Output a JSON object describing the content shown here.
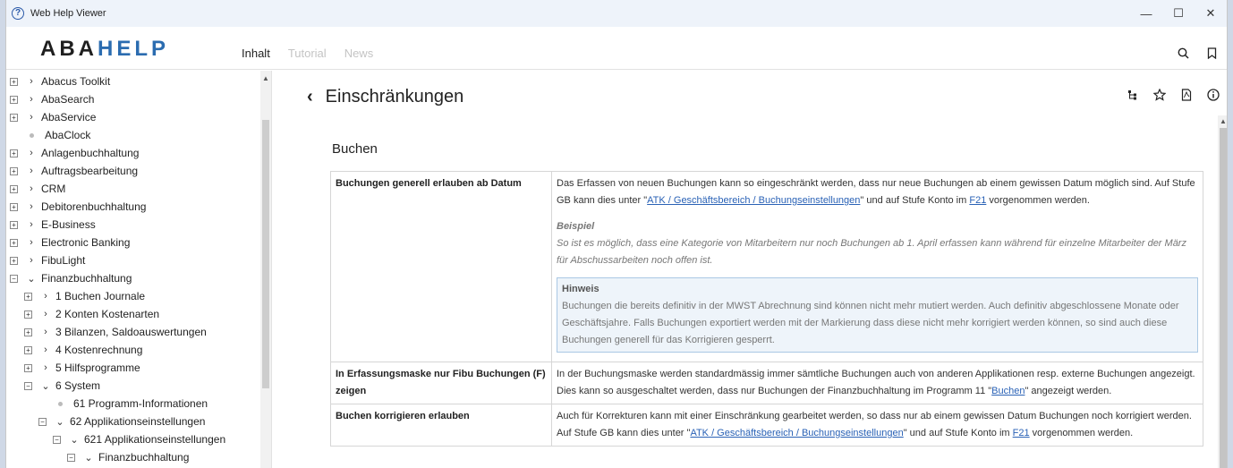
{
  "window": {
    "title": "Web Help Viewer",
    "minimize": "—",
    "maximize": "☐",
    "close": "✕"
  },
  "header": {
    "logo_a": "ABA",
    "logo_b": "HELP",
    "nav": {
      "inhalt": "Inhalt",
      "tutorial": "Tutorial",
      "news": "News"
    }
  },
  "sidebar": {
    "items": [
      {
        "label": "Abacus Toolkit",
        "box": "+",
        "chev": "›"
      },
      {
        "label": "AbaSearch",
        "box": "+",
        "chev": "›"
      },
      {
        "label": "AbaService",
        "box": "+",
        "chev": "›"
      },
      {
        "label": "AbaClock",
        "box": "",
        "chev": ""
      },
      {
        "label": "Anlagenbuchhaltung",
        "box": "+",
        "chev": "›"
      },
      {
        "label": "Auftragsbearbeitung",
        "box": "+",
        "chev": "›"
      },
      {
        "label": "CRM",
        "box": "+",
        "chev": "›"
      },
      {
        "label": "Debitorenbuchhaltung",
        "box": "+",
        "chev": "›"
      },
      {
        "label": "E-Business",
        "box": "+",
        "chev": "›"
      },
      {
        "label": "Electronic Banking",
        "box": "+",
        "chev": "›"
      },
      {
        "label": "FibuLight",
        "box": "+",
        "chev": "›"
      },
      {
        "label": "Finanzbuchhaltung",
        "box": "−",
        "chev": "⌄"
      },
      {
        "label": "1 Buchen Journale",
        "box": "+",
        "chev": "›"
      },
      {
        "label": "2 Konten Kostenarten",
        "box": "+",
        "chev": "›"
      },
      {
        "label": "3 Bilanzen, Saldoauswertungen",
        "box": "+",
        "chev": "›"
      },
      {
        "label": "4 Kostenrechnung",
        "box": "+",
        "chev": "›"
      },
      {
        "label": "5 Hilfsprogramme",
        "box": "+",
        "chev": "›"
      },
      {
        "label": "6 System",
        "box": "−",
        "chev": "⌄"
      },
      {
        "label": "61 Programm-Informationen",
        "box": "",
        "chev": ""
      },
      {
        "label": "62 Applikationseinstellungen",
        "box": "−",
        "chev": "⌄"
      },
      {
        "label": "621 Applikationseinstellungen",
        "box": "−",
        "chev": "⌄"
      },
      {
        "label": "Finanzbuchhaltung",
        "box": "−",
        "chev": "⌄"
      }
    ]
  },
  "content": {
    "title": "Einschränkungen",
    "section": "Buchen",
    "rows": {
      "r1": {
        "label": "Buchungen generell erlauben ab Datum",
        "text_a": "Das Erfassen von neuen Buchungen kann so eingeschränkt werden, dass nur neue Buchungen ab einem gewissen Datum möglich sind. Auf Stufe GB kann dies unter \"",
        "link_a": "ATK / Geschäftsbereich / Buchungseinstellungen",
        "text_b": "\" und auf Stufe Konto im ",
        "link_b": "F21",
        "text_c": " vorgenommen werden.",
        "example_title": "Beispiel",
        "example_text": "So ist es möglich, dass eine Kategorie von Mitarbeitern nur noch Buchungen ab 1. April erfassen kann während für einzelne Mitarbeiter der März für Abschussarbeiten noch offen ist.",
        "hint_title": "Hinweis",
        "hint_text": "Buchungen die bereits definitiv in der MWST Abrechnung sind können nicht mehr mutiert werden. Auch definitiv abgeschlossene Monate oder Geschäftsjahre. Falls Buchungen exportiert werden mit der Markierung dass diese nicht mehr korrigiert werden können, so sind auch diese Buchungen generell für das Korrigieren gesperrt."
      },
      "r2": {
        "label": "In Erfassungsmaske nur Fibu Buchungen (F) zeigen",
        "text_a": "In der Buchungsmaske werden standardmässig immer sämtliche Buchungen auch von anderen Applikationen resp. externe Buchungen angezeigt. Dies kann so ausgeschaltet werden, dass nur Buchungen der Finanzbuchhaltung im Programm 11 \"",
        "link_a": "Buchen",
        "text_b": "\" angezeigt werden."
      },
      "r3": {
        "label": "Buchen korrigieren erlauben",
        "text_a": "Auch für Korrekturen kann mit einer Einschränkung gearbeitet werden, so dass nur ab einem gewissen Datum Buchungen noch korrigiert werden. Auf Stufe GB kann dies unter \"",
        "link_a": "ATK / Geschäftsbereich / Buchungseinstellungen",
        "text_b": "\" und auf Stufe Konto im ",
        "link_b": "F21",
        "text_c": " vorgenommen werden."
      }
    }
  }
}
